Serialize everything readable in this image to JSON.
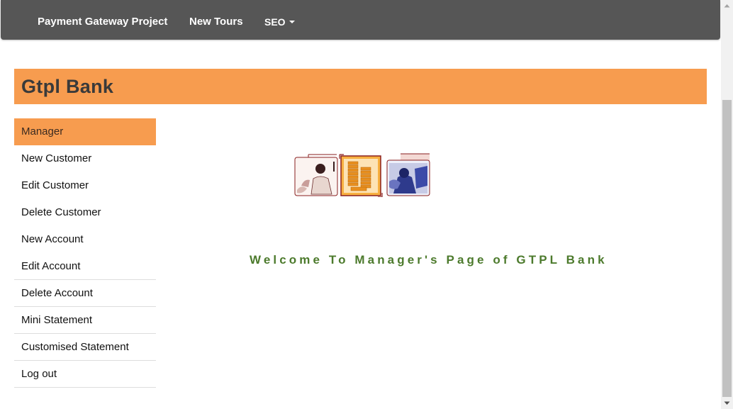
{
  "navbar": {
    "brand": "Payment Gateway Project",
    "new_tours": "New Tours",
    "seo": "SEO"
  },
  "header": {
    "title": "Gtpl Bank"
  },
  "menu": {
    "items": [
      "Manager",
      "New Customer",
      "Edit Customer",
      "Delete Customer",
      "New Account",
      "Edit Account",
      "Delete Account",
      "Mini Statement",
      "Customised Statement",
      "Log out"
    ]
  },
  "main": {
    "welcome": "Welcome To Manager's Page of GTPL Bank"
  },
  "colors": {
    "navbar": "#565656",
    "accent": "#f79c4f",
    "welcome_text": "#4c7a2c"
  }
}
